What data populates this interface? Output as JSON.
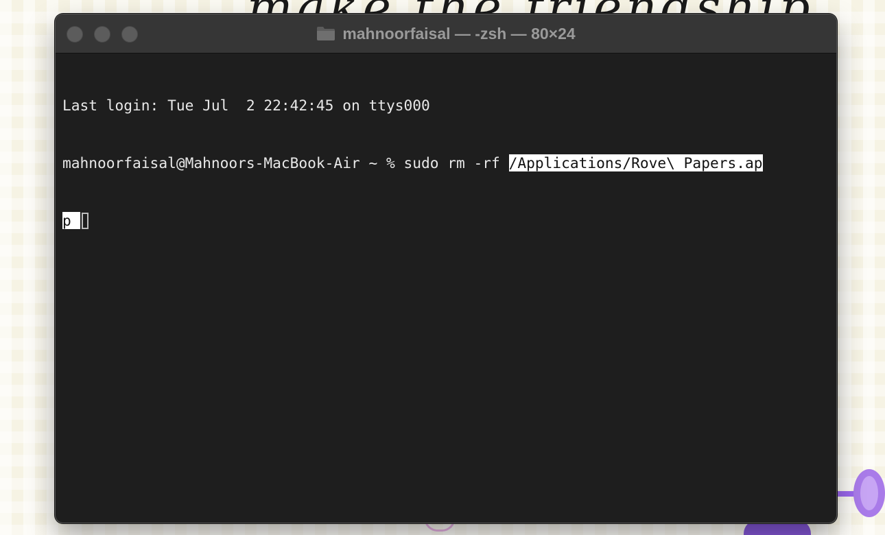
{
  "window": {
    "title": "mahnoorfaisal — -zsh — 80×24",
    "folder_icon": "folder-icon"
  },
  "terminal": {
    "last_login": "Last login: Tue Jul  2 22:42:45 on ttys000",
    "prompt": "mahnoorfaisal@Mahnoors-MacBook-Air ~ % ",
    "command": "sudo rm -rf ",
    "path_part1": "/Applications/Rove\\ Papers.ap",
    "path_part2": "p "
  },
  "colors": {
    "terminal_bg": "#1e1e1e",
    "title_bar_bg": "#363636",
    "text": "#e8e8e8",
    "selection_bg": "#ffffff"
  }
}
